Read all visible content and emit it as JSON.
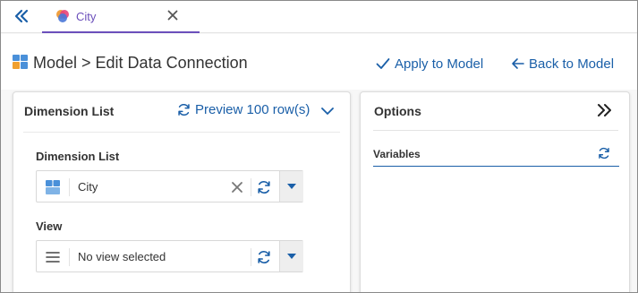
{
  "tab": {
    "label": "City",
    "icon": "city-model-icon",
    "accent": "#6b4fbb"
  },
  "header": {
    "title": "Model > Edit Data Connection",
    "apply_label": "Apply to Model",
    "back_label": "Back to Model"
  },
  "dimension_panel": {
    "title": "Dimension List",
    "preview_label": "Preview 100 row(s)",
    "dimension_field": {
      "label": "Dimension List",
      "value": "City"
    },
    "view_field": {
      "label": "View",
      "value": "No view selected"
    }
  },
  "options_panel": {
    "title": "Options",
    "variables_label": "Variables"
  },
  "colors": {
    "link": "#1a5fa8",
    "tab_accent": "#6b4fbb"
  }
}
